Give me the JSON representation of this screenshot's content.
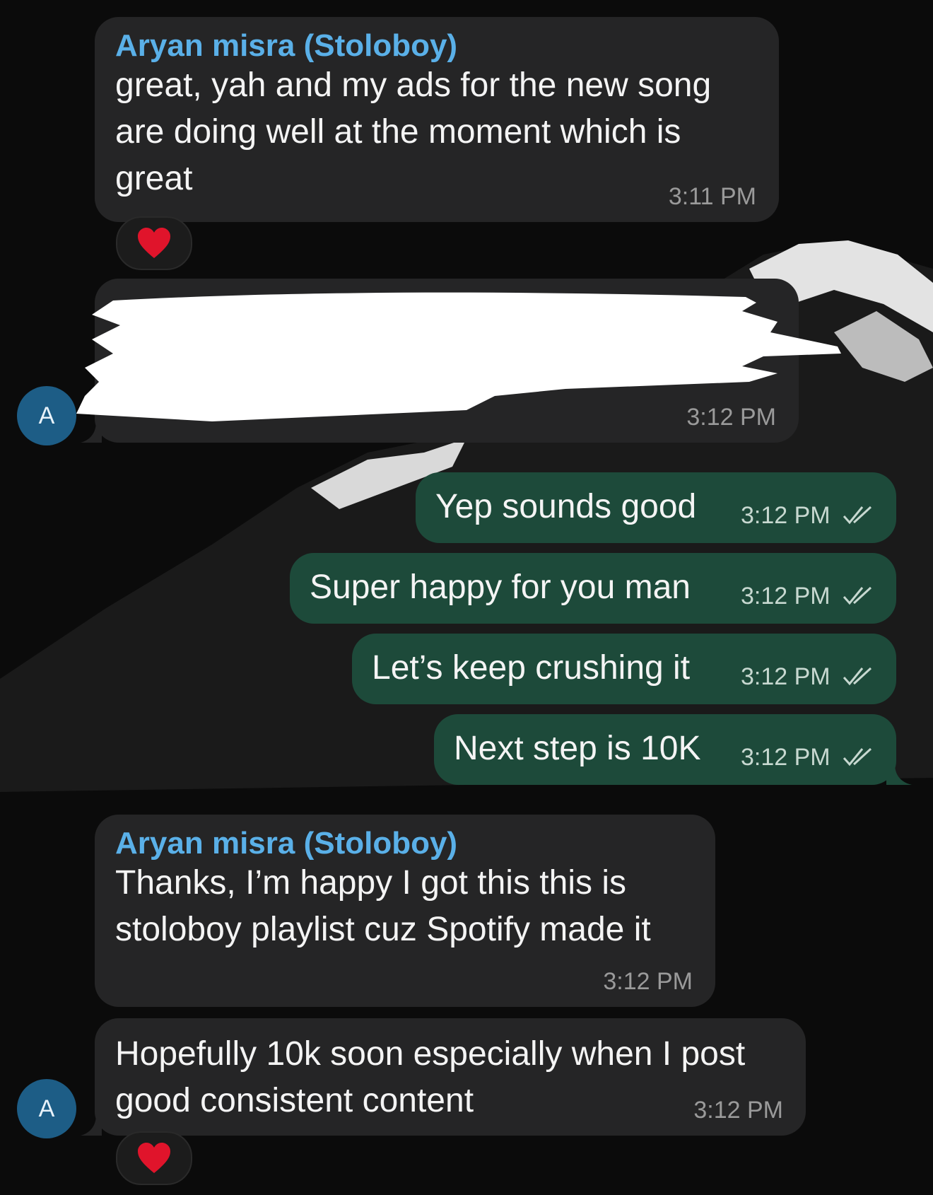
{
  "messages": [
    {
      "sender": "Aryan misra (Stoloboy)",
      "text": "great, yah and my ads for the new song\nare doing well at the moment which is\ngreat",
      "time": "3:11 PM",
      "reaction": "heart-emoji"
    },
    {
      "text": "",
      "time": "3:12 PM",
      "redacted": true
    },
    {
      "text": "Yep sounds good",
      "time": "3:12 PM",
      "status": "read"
    },
    {
      "text": "Super happy for you man",
      "time": "3:12 PM",
      "status": "read"
    },
    {
      "text": "Let’s keep crushing it",
      "time": "3:12 PM",
      "status": "read"
    },
    {
      "text": "Next step is 10K",
      "time": "3:12 PM",
      "status": "read"
    },
    {
      "sender": "Aryan misra (Stoloboy)",
      "text": "Thanks, I’m happy I got this this is\nstoloboy playlist cuz Spotify made it",
      "time": "3:12 PM"
    },
    {
      "text": "Hopefully 10k soon especially when I post\ngood consistent content",
      "time": "3:12 PM",
      "reaction": "heart-emoji"
    }
  ],
  "avatar_initial": "A",
  "colors": {
    "incoming": "#252526",
    "outgoing": "#1d4a3a",
    "sender": "#5ab0e8",
    "avatar": "#1d5d86"
  }
}
